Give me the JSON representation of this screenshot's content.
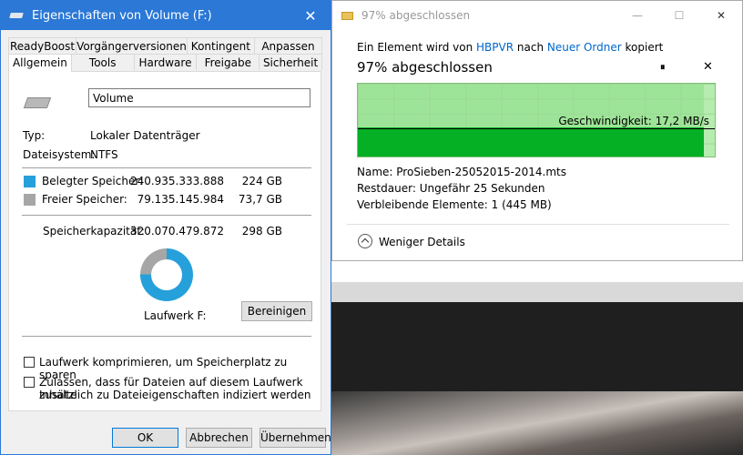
{
  "properties_dialog": {
    "title": "Eigenschaften von Volume (F:)",
    "close_glyph": "✕",
    "tabs_row1": [
      "ReadyBoost",
      "Vorgängerversionen",
      "Kontingent",
      "Anpassen"
    ],
    "tabs_row2": [
      "Allgemein",
      "Tools",
      "Hardware",
      "Freigabe",
      "Sicherheit"
    ],
    "active_tab": "Allgemein",
    "volume_name": "Volume",
    "type_label": "Typ:",
    "type_value": "Lokaler Datenträger",
    "fs_label": "Dateisystem:",
    "fs_value": "NTFS",
    "used_label": "Belegter Speicher:",
    "used_bytes": "240.935.333.888",
    "used_gb": "224 GB",
    "free_label": "Freier Speicher:",
    "free_bytes": "79.135.145.984",
    "free_gb": "73,7 GB",
    "capacity_label": "Speicherkapazität:",
    "capacity_bytes": "320.070.479.872",
    "capacity_gb": "298 GB",
    "used_percent": 75.3,
    "drive_label": "Laufwerk F:",
    "cleanup_button": "Bereinigen",
    "compress_checkbox": "Laufwerk komprimieren, um Speicherplatz zu sparen",
    "index_checkbox_line1": "Zulassen, dass für Dateien auf diesem Laufwerk Inhalte",
    "index_checkbox_line2": "zusätzlich zu Dateieigenschaften indiziert werden",
    "ok_button": "OK",
    "cancel_button": "Abbrechen",
    "apply_button": "Übernehmen",
    "colors": {
      "titlebar": "#2b78d6",
      "used": "#26a0da",
      "free": "#a6a6a6"
    }
  },
  "copy_dialog": {
    "title": "97% abgeschlossen",
    "minimize_glyph": "—",
    "maximize_glyph": "☐",
    "close_glyph": "✕",
    "desc_prefix": "Ein Element wird von",
    "source": "HBPVR",
    "desc_middle": "nach",
    "destination": "Neuer Ordner",
    "desc_suffix": "kopiert",
    "progress_heading": "97% abgeschlossen",
    "progress_percent": 97,
    "pause_glyph": "⏸",
    "cancel_glyph": "✕",
    "speed_text": "Geschwindigkeit: 17,2 MB/s",
    "name_label": "Name:",
    "name_value": "ProSieben-25052015-2014.mts",
    "remaining_label": "Restdauer:",
    "remaining_value": "Ungefähr 25 Sekunden",
    "items_label": "Verbleibende Elemente:",
    "items_value": "1 (445 MB)",
    "less_details": "Weniger Details",
    "colors": {
      "graph_bg": "#b7ecb0",
      "graph_fill": "#06b025",
      "link": "#0066cc"
    }
  }
}
